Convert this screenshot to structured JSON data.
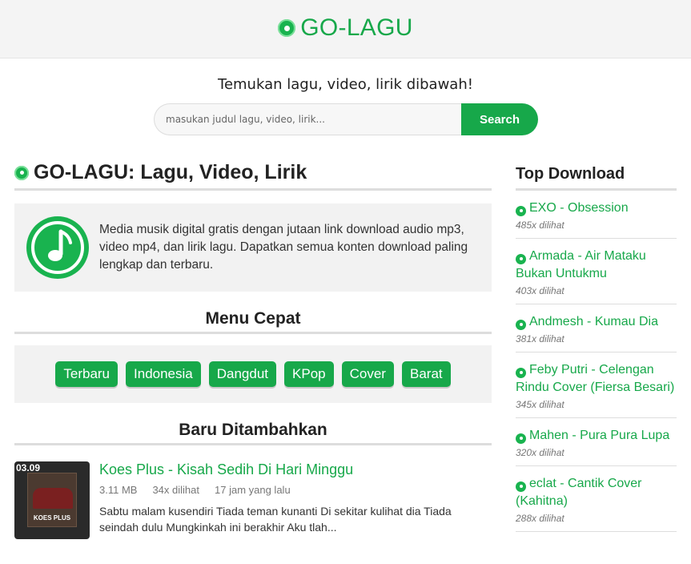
{
  "header": {
    "brand": "GO-LAGU",
    "logo_icon": "music-disc-icon"
  },
  "search": {
    "tagline": "Temukan lagu, video, lirik dibawah!",
    "placeholder": "masukan judul lagu, video, lirik...",
    "button_label": "Search"
  },
  "main": {
    "title": "GO-LAGU: Lagu, Video, Lirik",
    "intro": "Media musik digital gratis dengan jutaan link download audio mp3, video mp4, dan lirik lagu. Dapatkan semua konten download paling lengkap dan terbaru.",
    "menu_title": "Menu Cepat",
    "menu": [
      "Terbaru",
      "Indonesia",
      "Dangdut",
      "KPop",
      "Cover",
      "Barat"
    ],
    "new_title": "Baru Ditambahkan",
    "songs": [
      {
        "duration": "03.09",
        "thumb_label": "KOES PLUS",
        "title": "Koes Plus - Kisah Sedih Di Hari Minggu",
        "size": "3.11 MB",
        "views": "34x dilihat",
        "time": "17 jam yang lalu",
        "desc": "Sabtu malam kusendiri Tiada teman kunanti Di sekitar kulihat dia Tiada seindah dulu Mungkinkah ini berakhir Aku tlah..."
      }
    ]
  },
  "sidebar": {
    "title": "Top Download",
    "items": [
      {
        "label": "EXO - Obsession",
        "views": "485x dilihat"
      },
      {
        "label": "Armada - Air Mataku Bukan Untukmu",
        "views": "403x dilihat"
      },
      {
        "label": "Andmesh - Kumau Dia",
        "views": "381x dilihat"
      },
      {
        "label": "Feby Putri - Celengan Rindu Cover (Fiersa Besari)",
        "views": "345x dilihat"
      },
      {
        "label": "Mahen - Pura Pura Lupa",
        "views": "320x dilihat"
      },
      {
        "label": "eclat - Cantik Cover (Kahitna)",
        "views": "288x dilihat"
      }
    ]
  },
  "colors": {
    "accent": "#17a84a",
    "header_bg": "#f4f4f4",
    "box_bg": "#f2f2f2"
  }
}
